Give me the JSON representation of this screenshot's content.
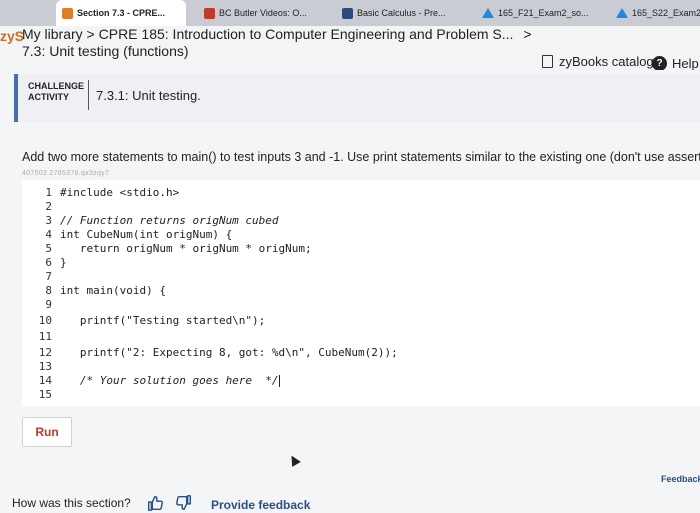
{
  "browser": {
    "tabs": [
      {
        "label": "Section 7.3 - CPRE...",
        "active": true,
        "icon": "zybooks-favicon"
      },
      {
        "label": "BC Butler Videos: O...",
        "active": false,
        "icon": "butler-favicon"
      },
      {
        "label": "Basic Calculus - Pre...",
        "active": false,
        "icon": "calculator-favicon"
      },
      {
        "label": "165_F21_Exam2_so...",
        "active": false,
        "icon": "drive-favicon"
      },
      {
        "label": "165_S22_Exam2_s...",
        "active": false,
        "icon": "drive-favicon"
      }
    ]
  },
  "header": {
    "logo_text": "zyS",
    "breadcrumb": "My library > CPRE 185: Introduction to Computer Engineering and Problem S...",
    "breadcrumb_caret": ">",
    "section_title": "7.3: Unit testing (functions)",
    "catalog_label": "zyBooks catalog",
    "help_label": "Help",
    "help_glyph": "?"
  },
  "challenge": {
    "tag_line1": "CHALLENGE",
    "tag_line2": "ACTIVITY",
    "title": "7.3.1: Unit testing."
  },
  "instructions": "Add two more statements to main() to test inputs 3 and -1. Use print statements similar to the existing one (don't use assert).",
  "problem_id": "407502.2765378.qx3zqy7",
  "code_lines": [
    {
      "num": "1",
      "text": "#include <stdio.h>"
    },
    {
      "num": "2",
      "text": ""
    },
    {
      "num": "3",
      "text": "// Function returns origNum cubed"
    },
    {
      "num": "4",
      "text": "int CubeNum(int origNum) {"
    },
    {
      "num": "5",
      "text": "   return origNum * origNum * origNum;"
    },
    {
      "num": "6",
      "text": "}"
    },
    {
      "num": "7",
      "text": ""
    },
    {
      "num": "8",
      "text": "int main(void) {"
    },
    {
      "num": "9",
      "text": ""
    },
    {
      "num": "10",
      "text": "   printf(\"Testing started\\n\");"
    },
    {
      "num": "11",
      "text": ""
    },
    {
      "num": "12",
      "text": "   printf(\"2: Expecting 8, got: %d\\n\", CubeNum(2));"
    },
    {
      "num": "13",
      "text": ""
    },
    {
      "num": "14",
      "text": "   /* Your solution goes here  */"
    },
    {
      "num": "15",
      "text": ""
    }
  ],
  "run_label": "Run",
  "feedback_label": "Feedback",
  "footer": {
    "question": "How was this section?",
    "provide_feedback": "Provide feedback"
  },
  "colors": {
    "accent_blue": "#2b4e86",
    "run_red": "#c0392b",
    "challenge_border": "#4a6ea9"
  }
}
